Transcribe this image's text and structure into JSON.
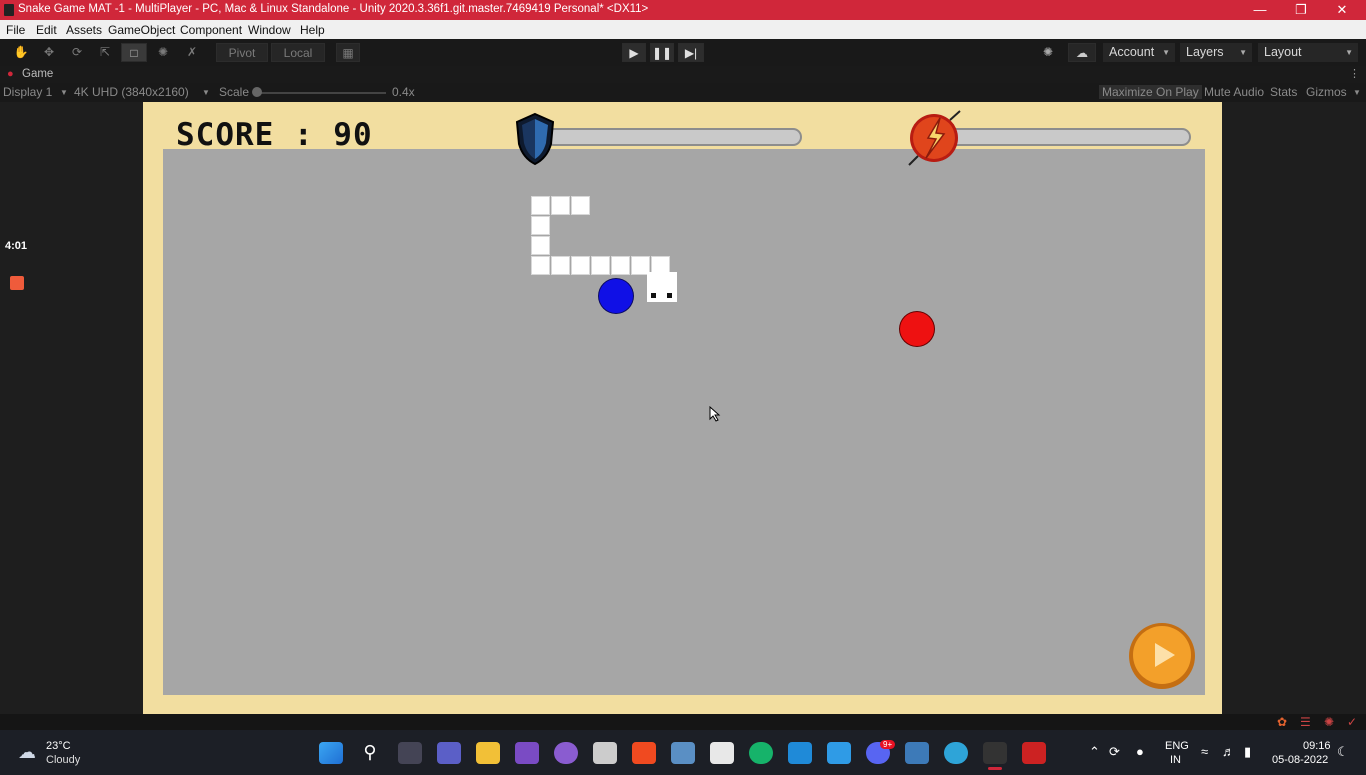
{
  "window": {
    "title": "Snake Game MAT -1 - MultiPlayer - PC, Mac & Linux Standalone - Unity 2020.3.36f1.git.master.7469419 Personal* <DX11>",
    "minimize_icon": "minimize-icon",
    "restore_icon": "restore-icon",
    "close_icon": "close-icon"
  },
  "menu": [
    "File",
    "Edit",
    "Assets",
    "GameObject",
    "Component",
    "Window",
    "Help"
  ],
  "toolbar": {
    "tools": [
      "hand-tool",
      "move-tool",
      "rotate-tool",
      "scale-tool",
      "rect-tool",
      "transform-tool",
      "custom-tool"
    ],
    "pivot_label": "Pivot",
    "local_label": "Local",
    "account_label": "Account",
    "layers_label": "Layers",
    "layout_label": "Layout"
  },
  "game_tab": {
    "tab_label": "Game",
    "display_label": "Display 1",
    "resolution_label": "4K UHD (3840x2160)",
    "scale_label": "Scale",
    "scale_value": "0.4x",
    "scale_fraction": 0.0,
    "maximize_label": "Maximize On Play",
    "mute_label": "Mute Audio",
    "stats_label": "Stats",
    "gizmos_label": "Gizmos"
  },
  "recorder": {
    "time": "4:01"
  },
  "game": {
    "score_text": "SCORE : 90",
    "shield_bar_fraction": 0.0,
    "speed_bar_fraction": 0.0,
    "colors": {
      "frame": "#f2dea0",
      "field": "#a6a6a6",
      "snake": "#ffffff",
      "blue_food": "#1010e6",
      "red_food": "#ee1111",
      "play_button": "#f3a02a"
    },
    "icons": [
      "shield-icon",
      "lightning-icon",
      "play-icon"
    ]
  },
  "taskbar": {
    "weather_temp": "23°C",
    "weather_desc": "Cloudy",
    "lang_line1": "ENG",
    "lang_line2": "IN",
    "time": "09:16",
    "date": "05-08-2022",
    "discord_badge": "9+"
  }
}
